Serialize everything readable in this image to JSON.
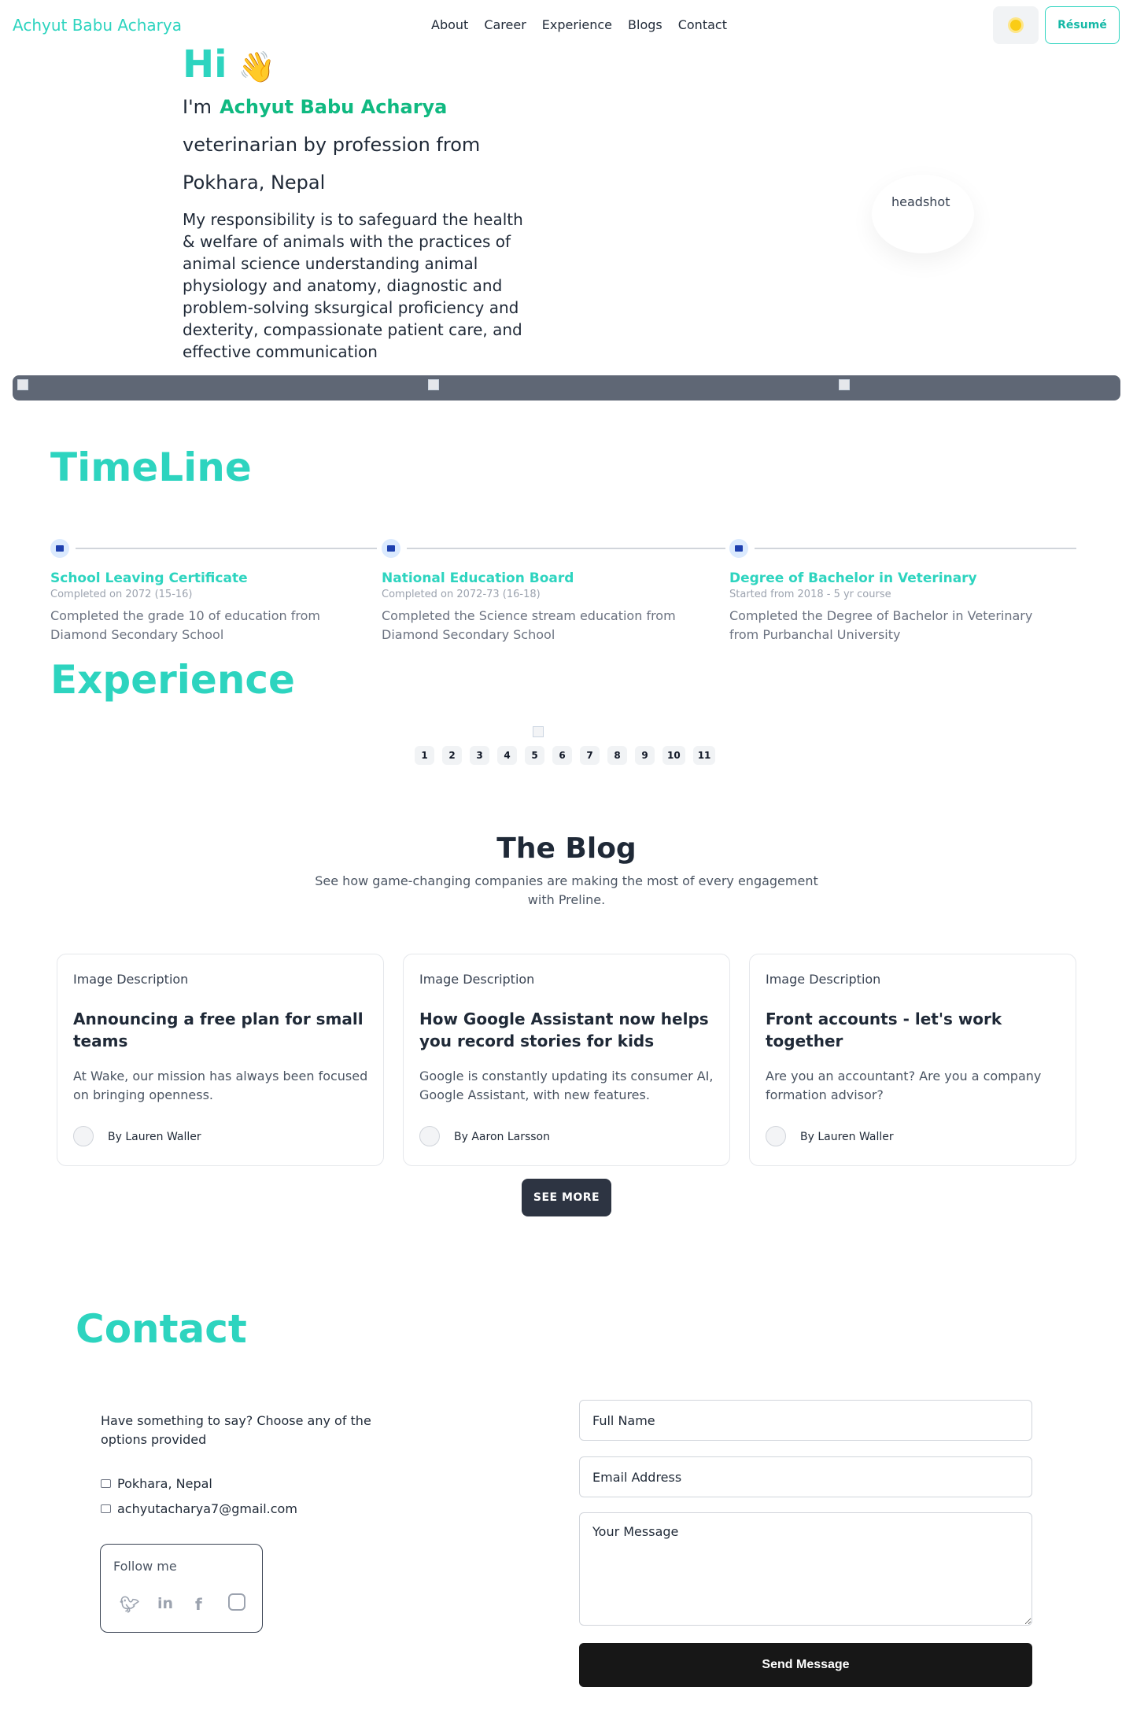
{
  "nav": {
    "brand": "Achyut Babu Acharya",
    "links": [
      "About",
      "Career",
      "Experience",
      "Blogs",
      "Contact"
    ],
    "theme_icon": "sun-icon",
    "resume_label": "Résumé"
  },
  "hero": {
    "greeting": "Hi",
    "wave": "👋",
    "intro_prefix": "I'm",
    "name": "Achyut Babu Acharya",
    "profession": "veterinarian by profession from",
    "location": "Pokhara, Nepal",
    "bio": "My responsibility is to safeguard the health & welfare of animals with the practices of animal science understanding animal physiology and anatomy, diagnostic and problem-solving sksurgical proficiency and dexterity, compassionate patient care, and effective communication",
    "headshot_alt": "headshot"
  },
  "timeline": {
    "title": "TimeLine",
    "items": [
      {
        "title": "School Leaving Certificate",
        "date": "Completed on 2072 (15-16)",
        "desc": "Completed the grade 10 of education from Diamond Secondary School"
      },
      {
        "title": "National Education Board",
        "date": "Completed on 2072-73 (16-18)",
        "desc": "Completed the Science stream education from Diamond Secondary School"
      },
      {
        "title": "Degree of Bachelor in Veterinary",
        "date": "Started from 2018 - 5 yr course",
        "desc": "Completed the Degree of Bachelor in Veterinary from Purbanchal University"
      }
    ]
  },
  "experience": {
    "title": "Experience",
    "pages": [
      "1",
      "2",
      "3",
      "4",
      "5",
      "6",
      "7",
      "8",
      "9",
      "10",
      "11"
    ]
  },
  "blog": {
    "title": "The Blog",
    "subtitle": "See how game-changing companies are making the most of every engagement with Preline.",
    "cards": [
      {
        "image_alt": "Image Description",
        "title": "Announcing a free plan for small teams",
        "desc": "At Wake, our mission has always been focused on bringing openness.",
        "author": "By Lauren Waller"
      },
      {
        "image_alt": "Image Description",
        "title": "How Google Assistant now helps you record stories for kids",
        "desc": "Google is constantly updating its consumer AI, Google Assistant, with new features.",
        "author": "By Aaron Larsson"
      },
      {
        "image_alt": "Image Description",
        "title": "Front accounts - let's work together",
        "desc": "Are you an accountant? Are you a company formation advisor?",
        "author": "By Lauren Waller"
      }
    ],
    "see_more": "SEE MORE"
  },
  "contact": {
    "title": "Contact",
    "intro": "Have something to say? Choose any of the options provided",
    "location": "Pokhara, Nepal",
    "email": "achyutacharya7@gmail.com",
    "follow_label": "Follow me",
    "socials": [
      "twitter-icon",
      "linkedin-icon",
      "facebook-icon",
      "instagram-icon"
    ],
    "form": {
      "name_placeholder": "Full Name",
      "email_placeholder": "Email Address",
      "message_placeholder": "Your Message",
      "send_label": "Send Message"
    }
  },
  "colors": {
    "accent": "#2dd4bf",
    "name_green": "#10b981",
    "banner": "#5f6775",
    "send_bg": "#171717"
  }
}
